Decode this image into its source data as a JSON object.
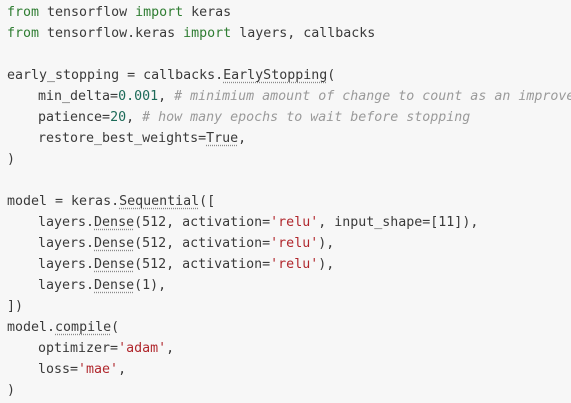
{
  "code": {
    "l1": {
      "kw_from": "from",
      "mod": " tensorflow ",
      "kw_import": "import",
      "name": " keras"
    },
    "l2": {
      "kw_from": "from",
      "mod": " tensorflow.keras ",
      "kw_import": "import",
      "names": " layers, callbacks"
    },
    "l4": {
      "var": "early_stopping = callbacks.",
      "cls": "EarlyStopping",
      "open": "("
    },
    "l5": {
      "arg": "min_delta=",
      "num": "0.001",
      "comma": ", ",
      "comment": "# minimium amount of change to count as an improvement"
    },
    "l6": {
      "arg": "patience=",
      "num": "20",
      "comma": ", ",
      "comment": "# how many epochs to wait before stopping"
    },
    "l7": {
      "arg": "restore_best_weights=",
      "val": "True",
      "comma": ","
    },
    "l8": {
      "close": ")"
    },
    "l10": {
      "var": "model = keras.",
      "cls": "Sequential",
      "open": "(["
    },
    "l11": {
      "pre": "layers.",
      "fn": "Dense",
      "args1": "(512, activation=",
      "str": "'relu'",
      "args2": ", input_shape=[11]),"
    },
    "l12": {
      "pre": "layers.",
      "fn": "Dense",
      "args1": "(512, activation=",
      "str": "'relu'",
      "args2": "),"
    },
    "l13": {
      "pre": "layers.",
      "fn": "Dense",
      "args1": "(512, activation=",
      "str": "'relu'",
      "args2": "),"
    },
    "l14": {
      "pre": "layers.",
      "fn": "Dense",
      "args1": "(1),"
    },
    "l15": {
      "close": "])"
    },
    "l16": {
      "pre": "model.",
      "fn": "compile",
      "open": "("
    },
    "l17": {
      "arg": "optimizer=",
      "str": "'adam'",
      "comma": ","
    },
    "l18": {
      "arg": "loss=",
      "str": "'mae'",
      "comma": ","
    },
    "l19": {
      "close": ")"
    }
  }
}
